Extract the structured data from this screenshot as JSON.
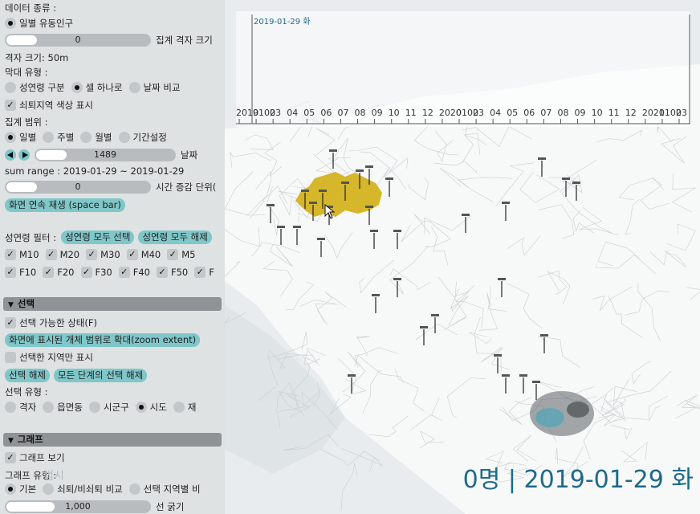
{
  "panel": {
    "data_type_label": "데이터 종류 :",
    "data_type_option": "일별 유동인구",
    "agg_grid_slider_value": "0",
    "agg_grid_label": "집계 격자 크기",
    "grid_size_label": "격자 크기: 50m",
    "bar_type_label": "막대 유형 :",
    "bar_type_options": [
      "성연령 구분",
      "셀 하나로",
      "날짜 비교"
    ],
    "decline_color_label": "쇠퇴지역 색상 표시",
    "agg_range_label": "집계 범위 :",
    "agg_range_options": [
      "일별",
      "주별",
      "월별",
      "기간설정"
    ],
    "date_slider_value": "1489",
    "date_label": "날짜",
    "sum_range": "sum range : 2019-01-29 ~ 2019-01-29",
    "time_inc_slider_value": "0",
    "time_inc_label": "시간 증감 단위(",
    "play_button": "화면 연속 재생 (space bar)",
    "age_filter_label": "성연령 필터 :",
    "select_all_button": "성연령 모두 선택",
    "deselect_all_button": "성연령 모두 해제",
    "male_items": [
      "M10",
      "M20",
      "M30",
      "M40",
      "M5"
    ],
    "female_items": [
      "F10",
      "F20",
      "F30",
      "F40",
      "F50",
      "F"
    ],
    "selection_section": "선택",
    "selectable_label": "선택 가능한 상태(F)",
    "zoom_extent_button": "화면에 표시된 개체 범위로 확대(zoom extent)",
    "selected_only_label": "선택한 지역만 표시",
    "clear_selection_button": "선택 해제",
    "clear_all_levels_button": "모든 단계의 선택 해제",
    "select_type_label": "선택 유형 :",
    "select_type_options": [
      "격자",
      "읍면동",
      "시군구",
      "시도",
      "재"
    ],
    "graph_section": "그래프",
    "show_graph_label": "그래프 보기",
    "graph_type_label": "그래프 유형 :",
    "graph_type_options": [
      "기본",
      "쇠퇴/비쇠퇴 비교",
      "선택 지역별 비"
    ],
    "line_width_value": "1,000",
    "line_width_label": "선 굵기",
    "faded_label": "범시"
  },
  "timeline": {
    "current_date": "2019-01-29 화",
    "ticks": [
      "2019",
      "0102",
      "03",
      "04",
      "05",
      "06",
      "07",
      "08",
      "09",
      "10",
      "11",
      "12",
      "2020",
      "0102",
      "03",
      "04",
      "05",
      "06",
      "07",
      "08",
      "09",
      "10",
      "11",
      "12",
      "2021",
      "0102",
      "03"
    ]
  },
  "overlay": {
    "status": "0명 | 2019-01-29 화"
  },
  "colors": {
    "accent": "#7fc7c9",
    "highlight_cluster": "#d4b21f",
    "status_text": "#1d6a8a",
    "cyan_cluster": "#3aa6c0"
  }
}
